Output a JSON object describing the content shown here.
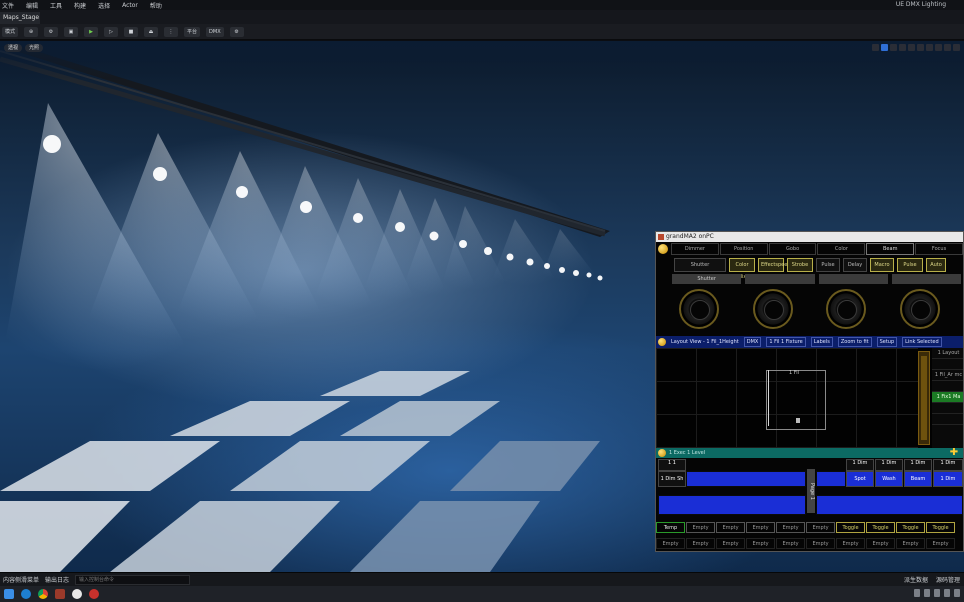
{
  "menubar": {
    "items": [
      "文件",
      "编辑",
      "工具",
      "构建",
      "选择",
      "Actor",
      "帮助"
    ],
    "project_title": "UE DMX Lighting"
  },
  "tab": {
    "label": "Maps_Stage"
  },
  "toolbar": {
    "items": [
      "模式",
      "",
      "",
      "",
      "",
      "",
      "",
      "",
      "平台",
      "DMX",
      "",
      ""
    ]
  },
  "viewport": {
    "btn_menu": "透视",
    "btn_lit": "光照"
  },
  "grandma": {
    "title": "grandMA2 onPC",
    "feature_tabs": [
      "Dimmer",
      "Position",
      "Gobo",
      "Color",
      "Beam",
      "Focus"
    ],
    "attrs": [
      "Shutter",
      "Color Mix",
      "Effectspeed 1",
      "Strobe",
      "Pulse",
      "Delay",
      "Macro",
      "Pulse Rndm",
      "Auto",
      "Strobe"
    ],
    "encoder_labels": [
      "Shutter",
      "",
      "",
      "",
      ""
    ],
    "layout_header": [
      "Layout View - 1 Fil_1Height",
      "DMX",
      "1 Fil 1 Fixture",
      "Labels",
      "Zoom to fit",
      "Setup",
      "Link Selected"
    ],
    "layout_box_label": "1 Fil",
    "side_items": [
      "1 Layout",
      "",
      "1 Fil_Ar mc",
      "",
      "1 Fix1 Ma",
      "",
      ""
    ],
    "exec_header": "1 Exec 1 Level",
    "exec_labels_top": [
      "1 1",
      "",
      "",
      "",
      "",
      "1 Dim",
      "1 Dim",
      "1 Dim",
      "1 Dim"
    ],
    "exec_labels_top2": [
      "1 Dim Sh",
      "",
      "",
      "",
      "",
      "Spot",
      "Wash",
      "Beam",
      "1 Dim"
    ],
    "exec_tag": "Page 1",
    "btn_row1": [
      "Temp",
      "Empty",
      "Empty",
      "Empty",
      "Empty",
      "Empty",
      "Toggle",
      "Toggle",
      "Toggle",
      "Toggle"
    ],
    "btn_row2": [
      "Empty",
      "Empty",
      "Empty",
      "Empty",
      "Empty",
      "Empty",
      "Empty",
      "Empty",
      "Empty",
      "Empty"
    ]
  },
  "statusbar": {
    "left": "内容侧滑菜单",
    "mid": "输出日志",
    "cmd_placeholder": "输入控制台命令",
    "right1": "派生数据",
    "right2": "源码管理"
  },
  "taskbar": {
    "apps": [
      "windows",
      "edge",
      "chrome",
      "ma",
      "unreal",
      "app"
    ]
  },
  "colors": {
    "menubar": "#101216",
    "accent": "#2f6fd6",
    "ma_blue": "#1a2ed6",
    "ma_yellow": "#b8b04a"
  }
}
